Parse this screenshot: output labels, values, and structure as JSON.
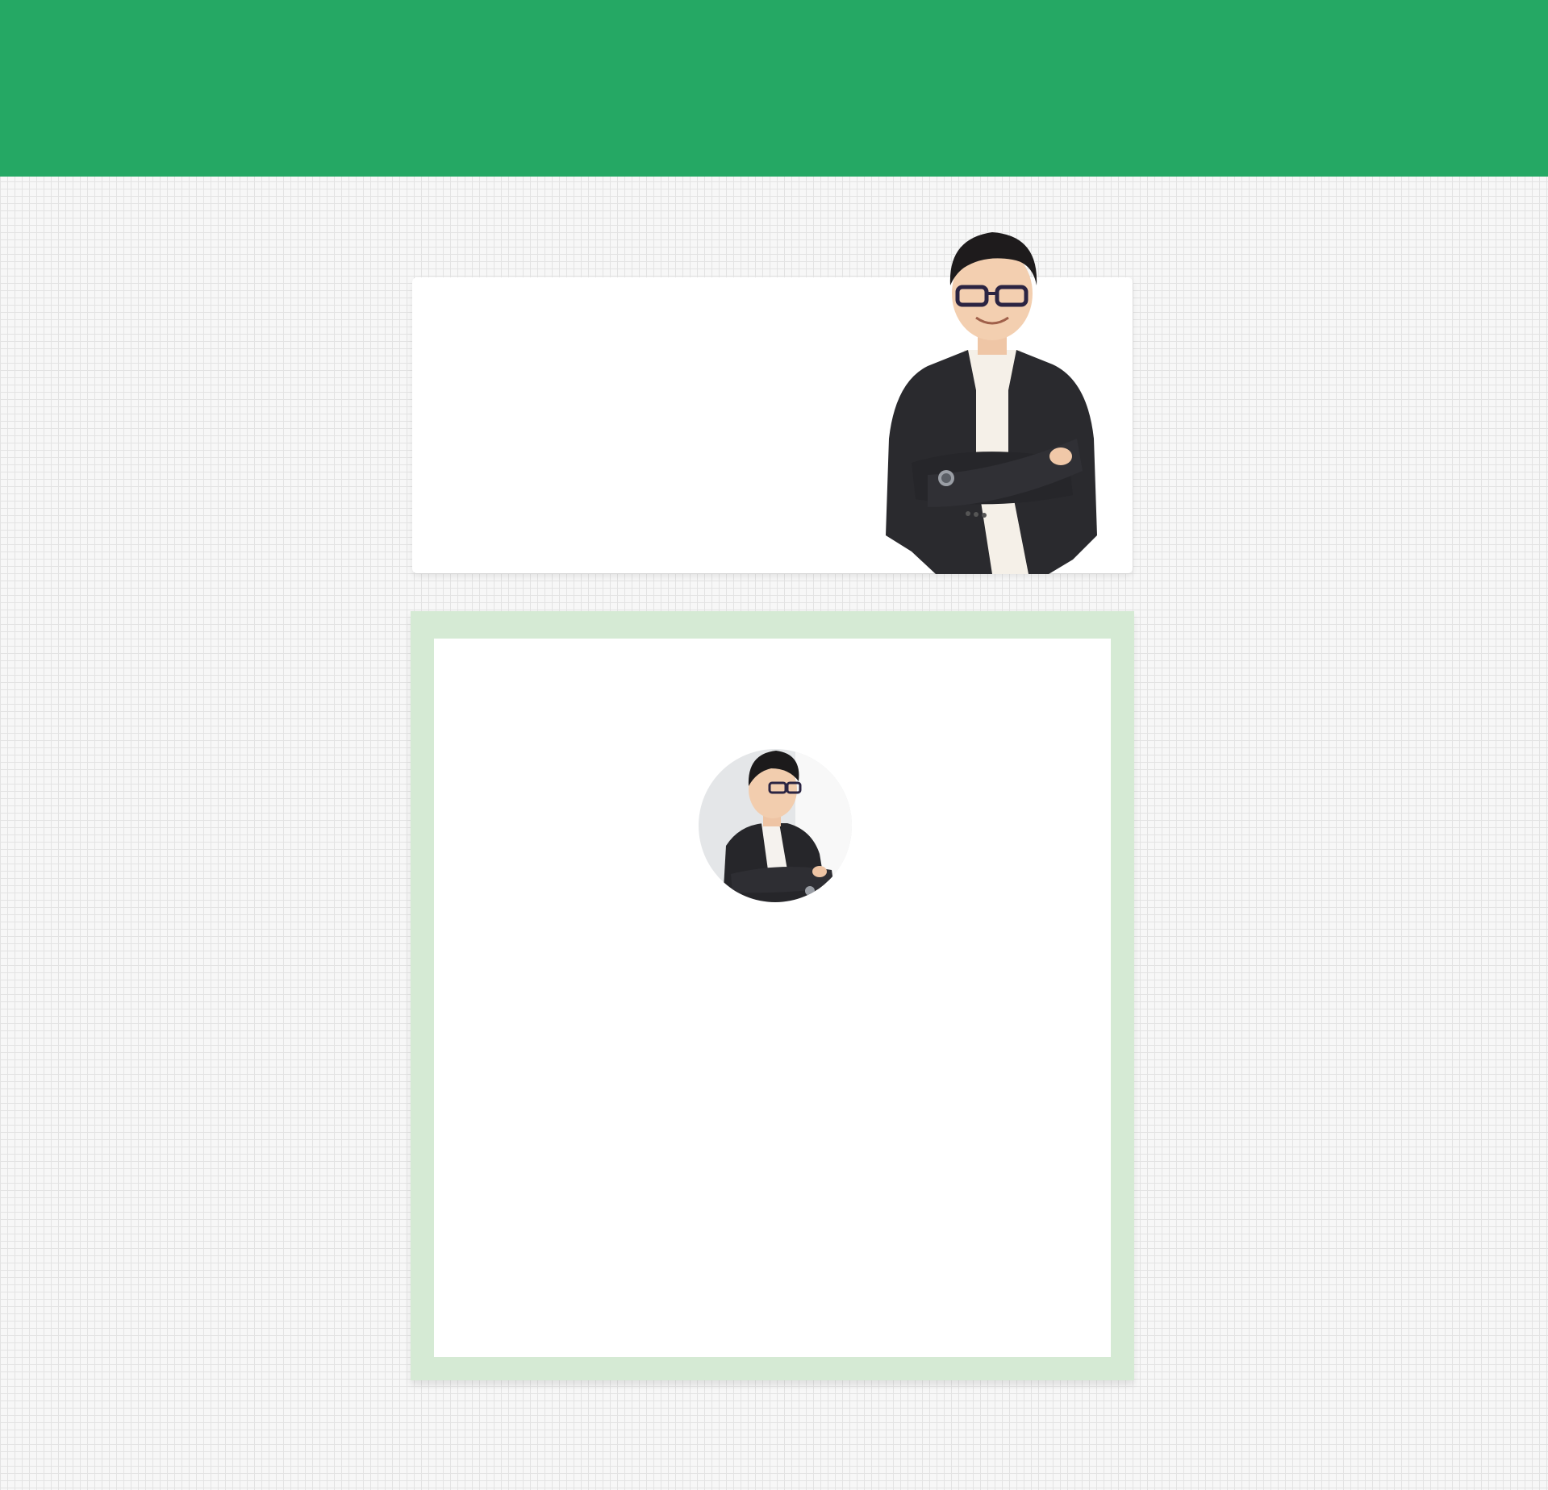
{
  "header": {
    "color": "#25a864"
  },
  "hero": {
    "photo_icon": "person-arms-crossed-smiling"
  },
  "profile": {
    "frame_color": "#d5ead4",
    "avatar_icon": "person-profile-avatar"
  }
}
